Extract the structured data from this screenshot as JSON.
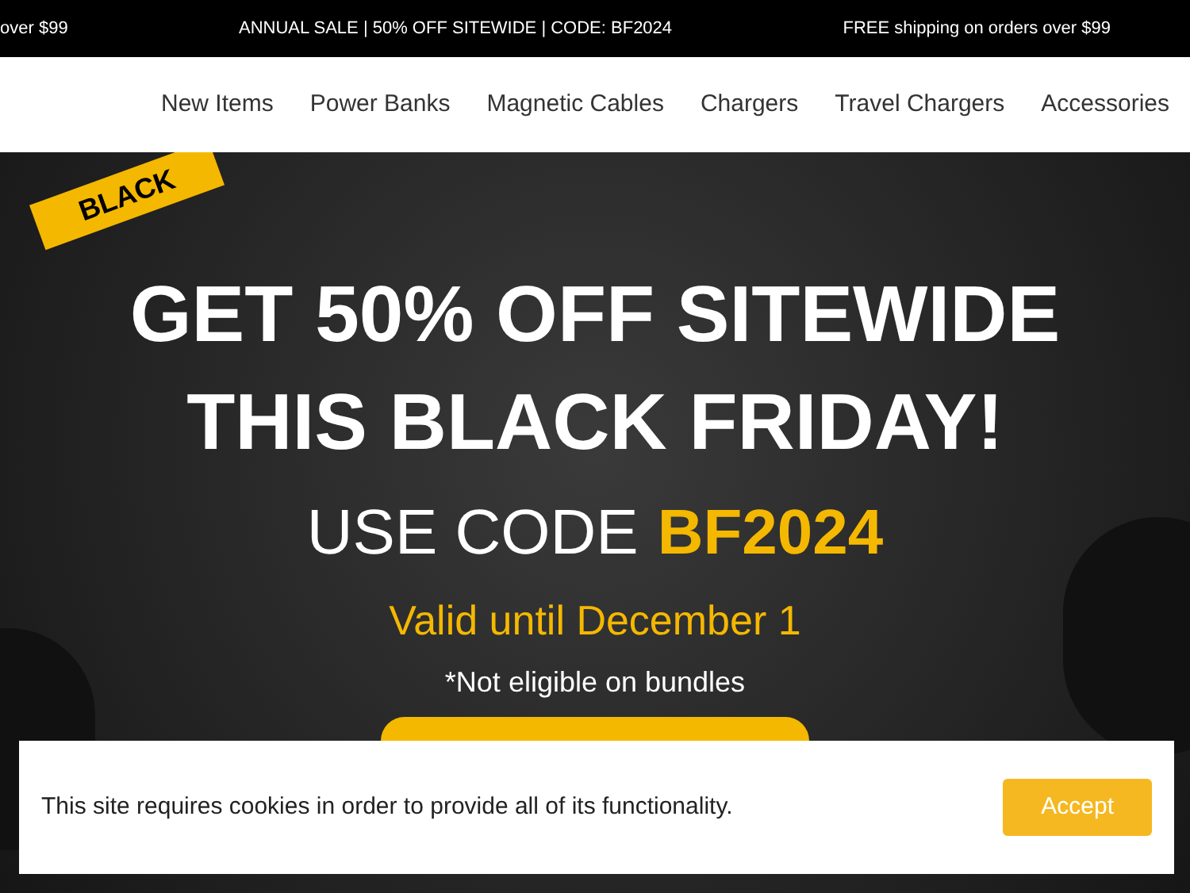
{
  "announcement_bar": {
    "messages": [
      "over $99",
      "ANNUAL SALE | 50% OFF SITEWIDE | CODE: BF2024",
      "FREE shipping on orders over $99"
    ]
  },
  "nav": {
    "items": [
      "New Items",
      "Power Banks",
      "Magnetic Cables",
      "Chargers",
      "Travel Chargers",
      "Accessories"
    ]
  },
  "hero": {
    "ribbon": "BLACK",
    "headline_1": "GET 50% OFF SITEWIDE",
    "headline_2": "THIS BLACK FRIDAY!",
    "code_prefix": "USE CODE",
    "code": "BF2024",
    "validity": "Valid until December 1",
    "note": "*Not eligible on bundles"
  },
  "cookie_banner": {
    "message": "This site requires cookies in order to provide all of its functionality.",
    "button": "Accept"
  }
}
